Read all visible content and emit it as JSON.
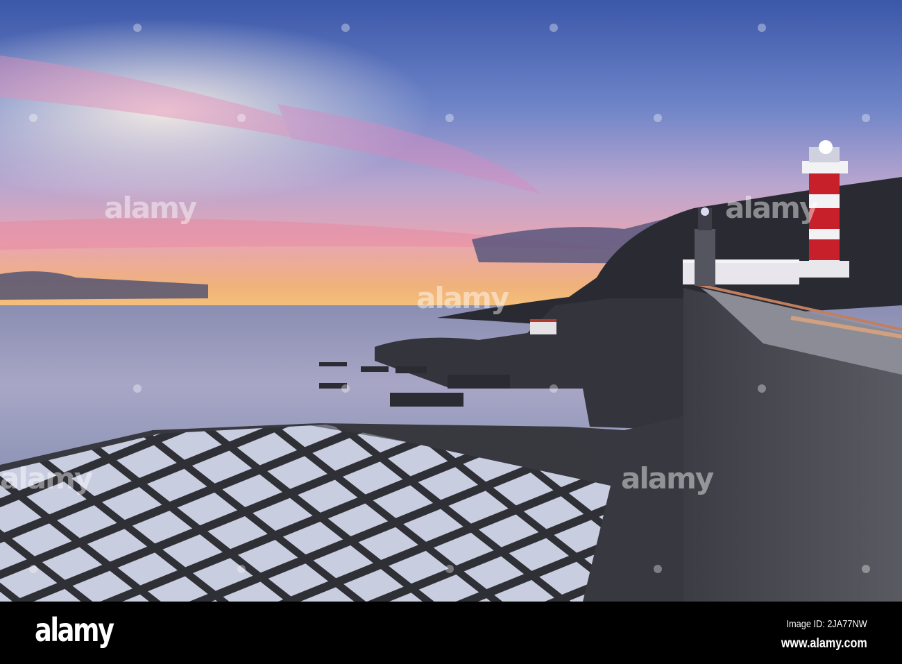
{
  "photo": {
    "colors": {
      "sky_top": "#3b57a9",
      "sky_pink": "#d88bb4",
      "horizon": "#f2b070",
      "sea": "#8e91b4",
      "stone": "#3f3f48",
      "lighthouse_red": "#c8202a"
    }
  },
  "watermark": {
    "text": "alamy"
  },
  "footer": {
    "logo": "alamy",
    "image_id": "Image ID: 2JA77NW",
    "url": "www.alamy.com"
  }
}
